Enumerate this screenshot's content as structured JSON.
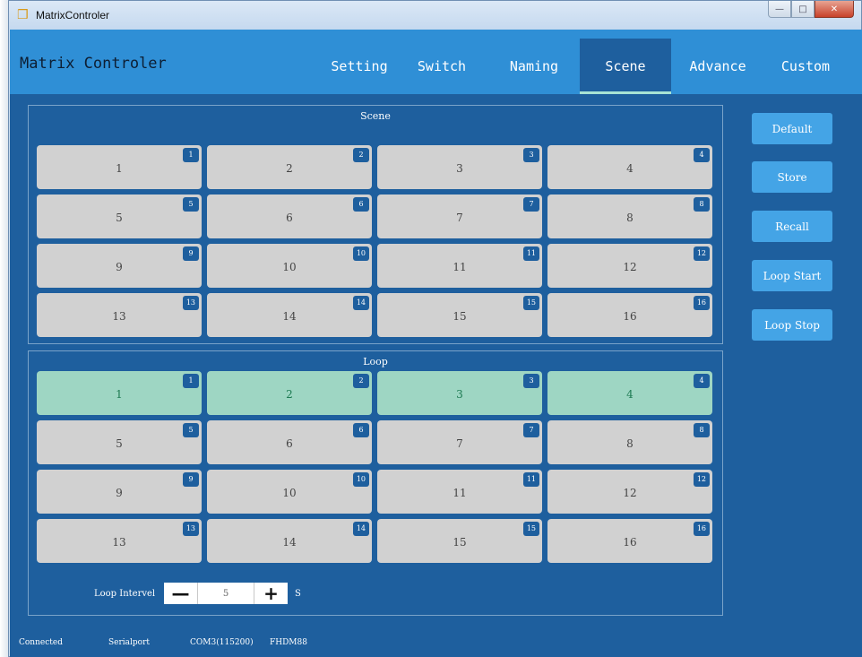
{
  "window": {
    "title": "MatrixControler"
  },
  "header": {
    "app_title": "Matrix Controler",
    "tabs": [
      {
        "label": "Setting",
        "active": false
      },
      {
        "label": "Switch",
        "active": false
      },
      {
        "label": "Naming",
        "active": false
      },
      {
        "label": "Scene",
        "active": true
      },
      {
        "label": "Advance",
        "active": false
      },
      {
        "label": "Custom",
        "active": false
      }
    ]
  },
  "scene_panel": {
    "title": "Scene",
    "tiles": [
      {
        "label": "1",
        "badge": "1"
      },
      {
        "label": "2",
        "badge": "2"
      },
      {
        "label": "3",
        "badge": "3"
      },
      {
        "label": "4",
        "badge": "4"
      },
      {
        "label": "5",
        "badge": "5"
      },
      {
        "label": "6",
        "badge": "6"
      },
      {
        "label": "7",
        "badge": "7"
      },
      {
        "label": "8",
        "badge": "8"
      },
      {
        "label": "9",
        "badge": "9"
      },
      {
        "label": "10",
        "badge": "10"
      },
      {
        "label": "11",
        "badge": "11"
      },
      {
        "label": "12",
        "badge": "12"
      },
      {
        "label": "13",
        "badge": "13"
      },
      {
        "label": "14",
        "badge": "14"
      },
      {
        "label": "15",
        "badge": "15"
      },
      {
        "label": "16",
        "badge": "16"
      }
    ]
  },
  "loop_panel": {
    "title": "Loop",
    "tiles": [
      {
        "label": "1",
        "badge": "1",
        "selected": true
      },
      {
        "label": "2",
        "badge": "2",
        "selected": true
      },
      {
        "label": "3",
        "badge": "3",
        "selected": true
      },
      {
        "label": "4",
        "badge": "4",
        "selected": true
      },
      {
        "label": "5",
        "badge": "5",
        "selected": false
      },
      {
        "label": "6",
        "badge": "6",
        "selected": false
      },
      {
        "label": "7",
        "badge": "7",
        "selected": false
      },
      {
        "label": "8",
        "badge": "8",
        "selected": false
      },
      {
        "label": "9",
        "badge": "9",
        "selected": false
      },
      {
        "label": "10",
        "badge": "10",
        "selected": false
      },
      {
        "label": "11",
        "badge": "11",
        "selected": false
      },
      {
        "label": "12",
        "badge": "12",
        "selected": false
      },
      {
        "label": "13",
        "badge": "13",
        "selected": false
      },
      {
        "label": "14",
        "badge": "14",
        "selected": false
      },
      {
        "label": "15",
        "badge": "15",
        "selected": false
      },
      {
        "label": "16",
        "badge": "16",
        "selected": false
      }
    ],
    "interval": {
      "label": "Loop Intervel",
      "value": "5",
      "unit": "S",
      "minus": "—",
      "plus": "+"
    }
  },
  "actions": {
    "default": "Default",
    "store": "Store",
    "recall": "Recall",
    "loop_start": "Loop Start",
    "loop_stop": "Loop Stop"
  },
  "status_bar": {
    "connection": "Connected",
    "port_type": "Serialport",
    "port": "COM3(115200)",
    "device": "FHDM88"
  },
  "colors": {
    "header": "#2f8fd6",
    "body": "#1e5f9e",
    "tile": "#d1d1d1",
    "tile_selected": "#9ed6c3",
    "action_button": "#44a4e6"
  }
}
